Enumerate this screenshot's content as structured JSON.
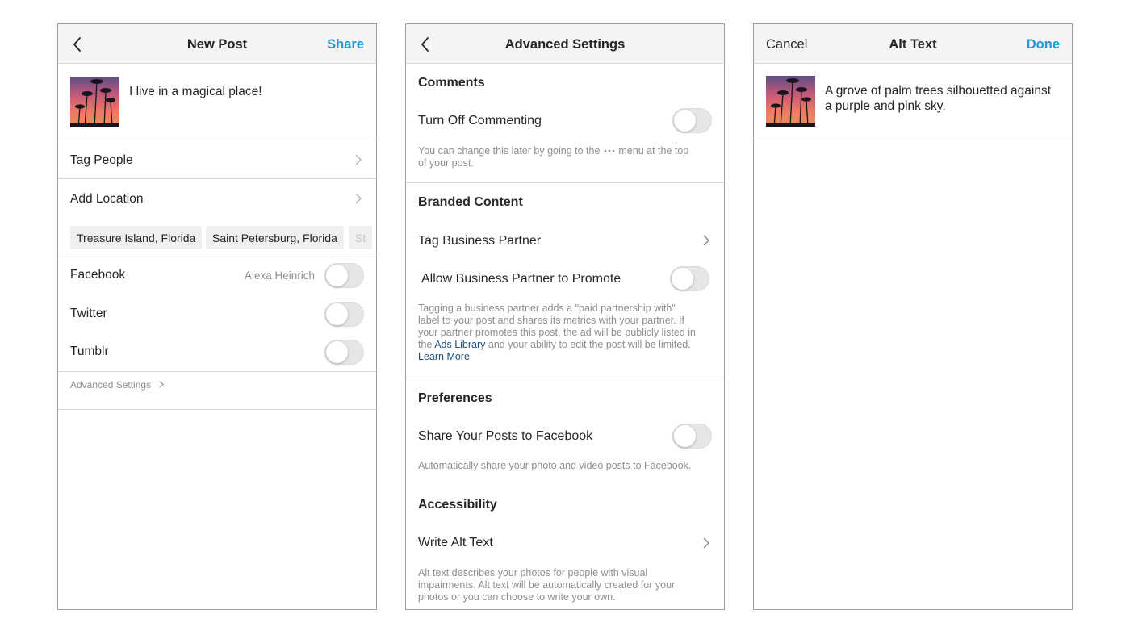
{
  "new_post": {
    "title": "New Post",
    "share_label": "Share",
    "caption": "I live in a magical place!",
    "tag_people": "Tag People",
    "add_location": "Add Location",
    "location_chips": [
      "Treasure Island, Florida",
      "Saint Petersburg, Florida",
      "St"
    ],
    "facebook_label": "Facebook",
    "facebook_account": "Alexa Heinrich",
    "twitter_label": "Twitter",
    "tumblr_label": "Tumblr",
    "advanced_settings": "Advanced Settings"
  },
  "advanced": {
    "title": "Advanced Settings",
    "comments_header": "Comments",
    "turn_off_commenting": "Turn Off Commenting",
    "commenting_hint_1": "You can change this later by going to the",
    "commenting_hint_2": "menu at the top",
    "commenting_hint_3": "of your post.",
    "branded_header": "Branded Content",
    "tag_business_partner": "Tag Business Partner",
    "allow_partner_promote": "Allow Business Partner to Promote",
    "branded_hint_1": "Tagging a business partner adds a \"paid partnership with\"",
    "branded_hint_2": "label to your post and shares its metrics with your partner. If",
    "branded_hint_3": "your partner promotes this post, the ad will be publicly listed in",
    "branded_hint_4_pre": "the",
    "ads_library": "Ads Library",
    "branded_hint_4_post": "and your ability to edit the post will be limited.",
    "learn_more": "Learn More",
    "preferences_header": "Preferences",
    "share_to_facebook": "Share Your Posts to Facebook",
    "share_hint": "Automatically share your photo and video posts to Facebook.",
    "accessibility_header": "Accessibility",
    "write_alt_text": "Write Alt Text",
    "alt_hint_1": "Alt text describes your photos for people with visual",
    "alt_hint_2": "impairments. Alt text will be automatically created for your",
    "alt_hint_3": "photos or you can choose to write your own."
  },
  "alt_text": {
    "cancel_label": "Cancel",
    "title": "Alt Text",
    "done_label": "Done",
    "text_line_1": "A grove of palm trees silhouetted against",
    "text_line_2": "a purple and pink sky."
  },
  "icons": {
    "back": "chevron-left-icon",
    "chevron": "chevron-right-icon",
    "more": "more-dots-icon"
  },
  "colors": {
    "accent_blue": "#1f9ad8",
    "link_blue": "#1d4d7a",
    "header_bg": "#f4f4f4",
    "text": "#262626",
    "muted": "#8e8e8e",
    "toggle_off": "#e6e6e6"
  },
  "toggles": {
    "facebook": false,
    "twitter": false,
    "tumblr": false,
    "turn_off_commenting": false,
    "allow_partner_promote": false,
    "share_to_facebook": false
  }
}
